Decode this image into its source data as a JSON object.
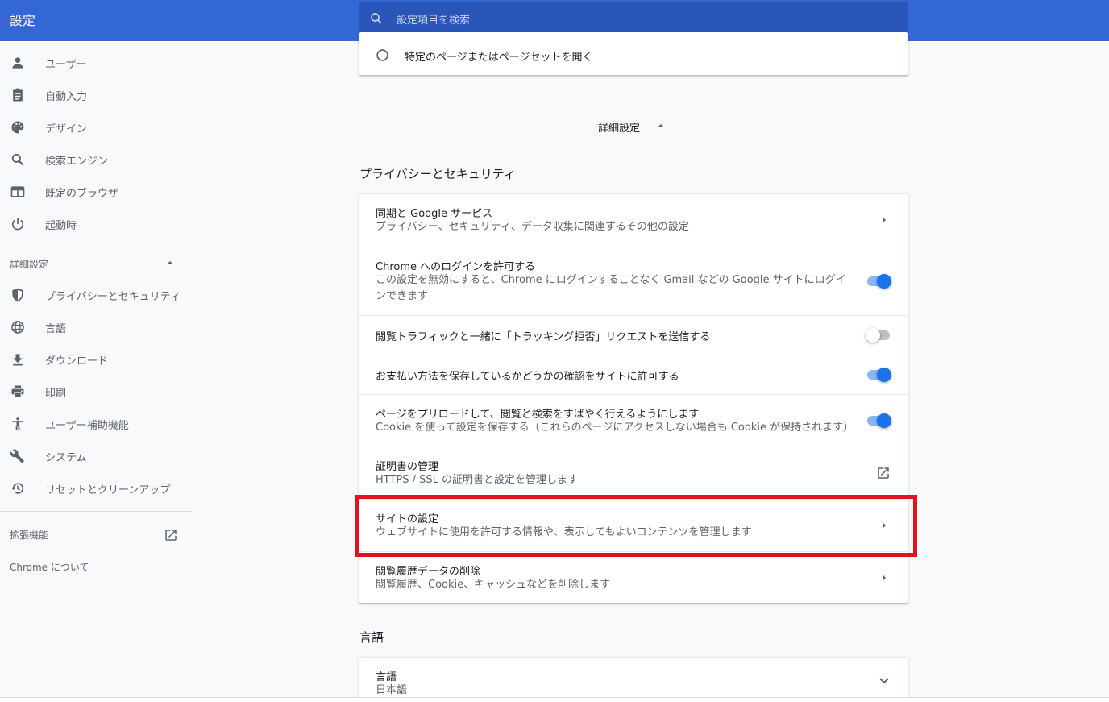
{
  "header": {
    "title": "設定",
    "search_placeholder": "設定項目を検索"
  },
  "sidebar": {
    "items": [
      {
        "label": "ユーザー",
        "icon": "person-icon"
      },
      {
        "label": "自動入力",
        "icon": "clipboard-icon"
      },
      {
        "label": "デザイン",
        "icon": "palette-icon"
      },
      {
        "label": "検索エンジン",
        "icon": "search-icon"
      },
      {
        "label": "既定のブラウザ",
        "icon": "browser-icon"
      },
      {
        "label": "起動時",
        "icon": "power-icon"
      }
    ],
    "advanced_label": "詳細設定",
    "advanced_items": [
      {
        "label": "プライバシーとセキュリティ",
        "icon": "shield-icon"
      },
      {
        "label": "言語",
        "icon": "globe-icon"
      },
      {
        "label": "ダウンロード",
        "icon": "download-icon"
      },
      {
        "label": "印刷",
        "icon": "printer-icon"
      },
      {
        "label": "ユーザー補助機能",
        "icon": "accessibility-icon"
      },
      {
        "label": "システム",
        "icon": "wrench-icon"
      },
      {
        "label": "リセットとクリーンアップ",
        "icon": "history-icon"
      }
    ],
    "extensions_label": "拡張機能",
    "about_label": "Chrome について"
  },
  "startup": {
    "radio_label": "特定のページまたはページセットを開く"
  },
  "advanced_toggle_label": "詳細設定",
  "privacy": {
    "title": "プライバシーとセキュリティ",
    "rows": [
      {
        "title": "同期と Google サービス",
        "subtitle": "プライバシー、セキュリティ、データ収集に関連するその他の設定",
        "control": "arrow"
      },
      {
        "title": "Chrome へのログインを許可する",
        "subtitle": "この設定を無効にすると、Chrome にログインすることなく Gmail などの Google サイトにログインできます",
        "control": "toggle",
        "on": true
      },
      {
        "title": "閲覧トラフィックと一緒に「トラッキング拒否」リクエストを送信する",
        "subtitle": "",
        "control": "toggle",
        "on": false
      },
      {
        "title": "お支払い方法を保存しているかどうかの確認をサイトに許可する",
        "subtitle": "",
        "control": "toggle",
        "on": true
      },
      {
        "title": "ページをプリロードして、閲覧と検索をすばやく行えるようにします",
        "subtitle": "Cookie を使って設定を保存する（これらのページにアクセスしない場合も Cookie が保持されます）",
        "control": "toggle",
        "on": true
      },
      {
        "title": "証明書の管理",
        "subtitle": "HTTPS / SSL の証明書と設定を管理します",
        "control": "external"
      },
      {
        "title": "サイトの設定",
        "subtitle": "ウェブサイトに使用を許可する情報や、表示してもよいコンテンツを管理します",
        "control": "arrow"
      },
      {
        "title": "閲覧履歴データの削除",
        "subtitle": "閲覧履歴、Cookie、キャッシュなどを削除します",
        "control": "arrow"
      }
    ]
  },
  "language": {
    "title": "言語",
    "row_title": "言語",
    "row_value": "日本語"
  },
  "colors": {
    "header": "#3367d6",
    "accent": "#1a73e8",
    "highlight": "#e0141e"
  }
}
